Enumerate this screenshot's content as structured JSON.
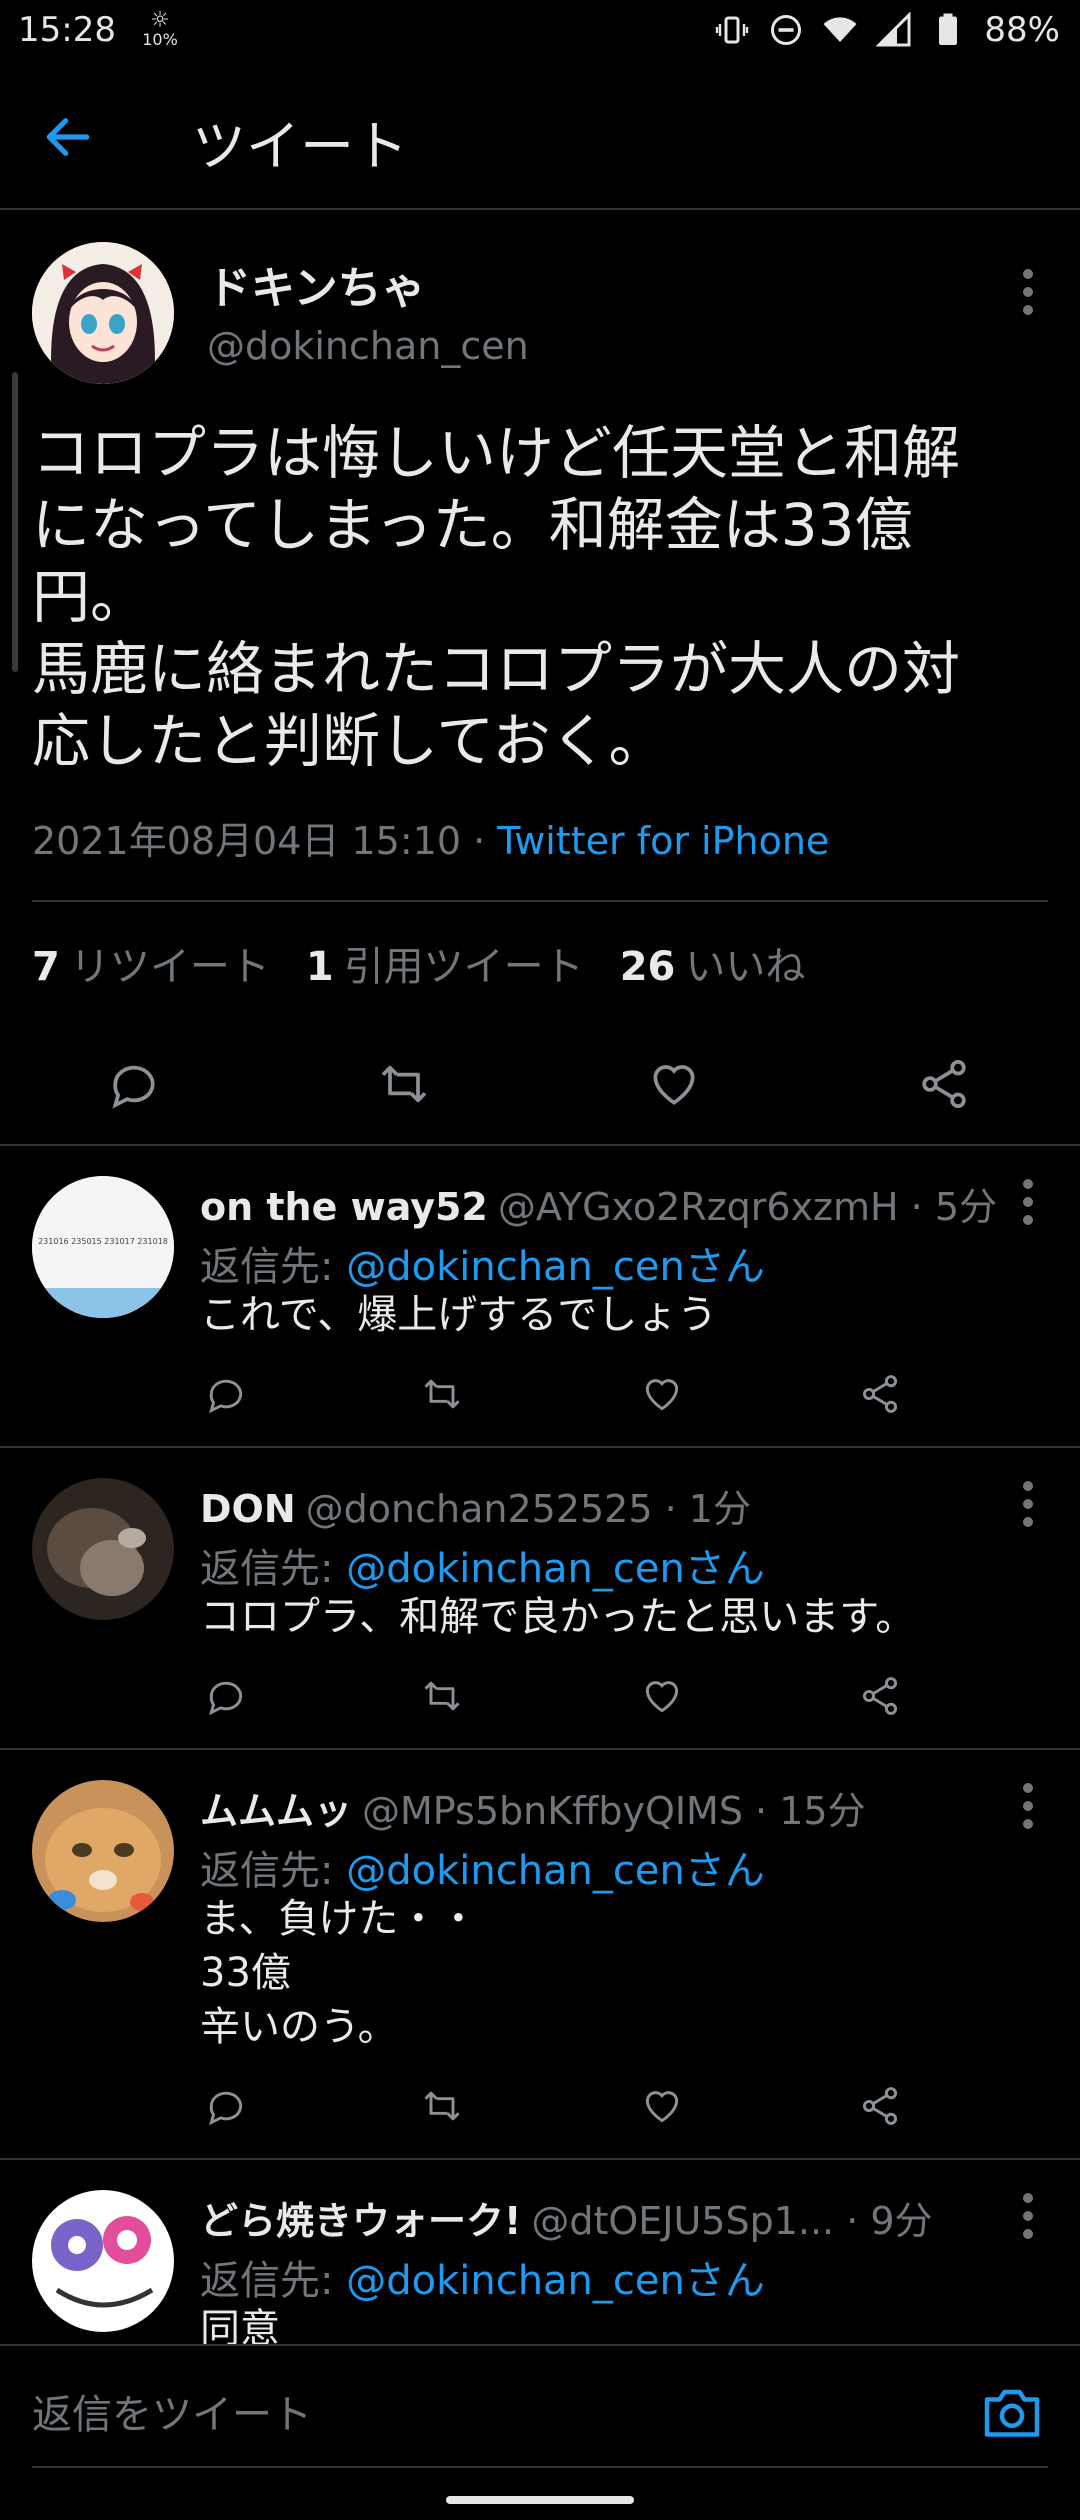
{
  "status_bar": {
    "time": "15:28",
    "brightness": "10%",
    "battery": "88%"
  },
  "header": {
    "title": "ツイート"
  },
  "main_tweet": {
    "display_name": "ドキンちゃ",
    "handle": "@dokinchan_cen",
    "text": "コロプラは悔しいけど任天堂と和解\nになってしまった。和解金は33億\n円。\n馬鹿に絡まれたコロプラが大人の対\n応したと判断しておく。",
    "timestamp": "2021年08月04日 15:10",
    "separator": " · ",
    "source": "Twitter for iPhone",
    "stats": {
      "retweets_count": "7",
      "retweets_label": "リツイート",
      "quotes_count": "1",
      "quotes_label": "引用ツイート",
      "likes_count": "26",
      "likes_label": "いいね"
    }
  },
  "replies": [
    {
      "name": "on the way52",
      "handle": "@AYGxo2Rzqr6xzmH",
      "time": " · 5分",
      "reply_prefix": "返信先: ",
      "reply_to": "@dokinchan_cenさん",
      "text": "これで、爆上げするでしょう",
      "avatar_label": "231016 235015 231017 231018"
    },
    {
      "name": "DON",
      "handle": "@donchan252525",
      "time": " · 1分",
      "reply_prefix": "返信先: ",
      "reply_to": "@dokinchan_cenさん",
      "text": "コロプラ、和解で良かったと思います。"
    },
    {
      "name": "ムムムッ",
      "handle": "@MPs5bnKffbyQIMS",
      "time": " · 15分",
      "reply_prefix": "返信先: ",
      "reply_to": "@dokinchan_cenさん",
      "text": "ま、負けた・・\n33億\n辛いのう。"
    },
    {
      "name": "どら焼きウォーク!",
      "handle": "@dtOEJU5Sp1...",
      "time": " · 9分",
      "reply_prefix": "返信先: ",
      "reply_to": "@dokinchan_cenさん",
      "text": "同意"
    }
  ],
  "compose": {
    "placeholder": "返信をツイート"
  },
  "colors": {
    "accent": "#1d9bf0",
    "background": "#000000",
    "secondary_text": "#71767b",
    "divider": "#2f3336"
  }
}
